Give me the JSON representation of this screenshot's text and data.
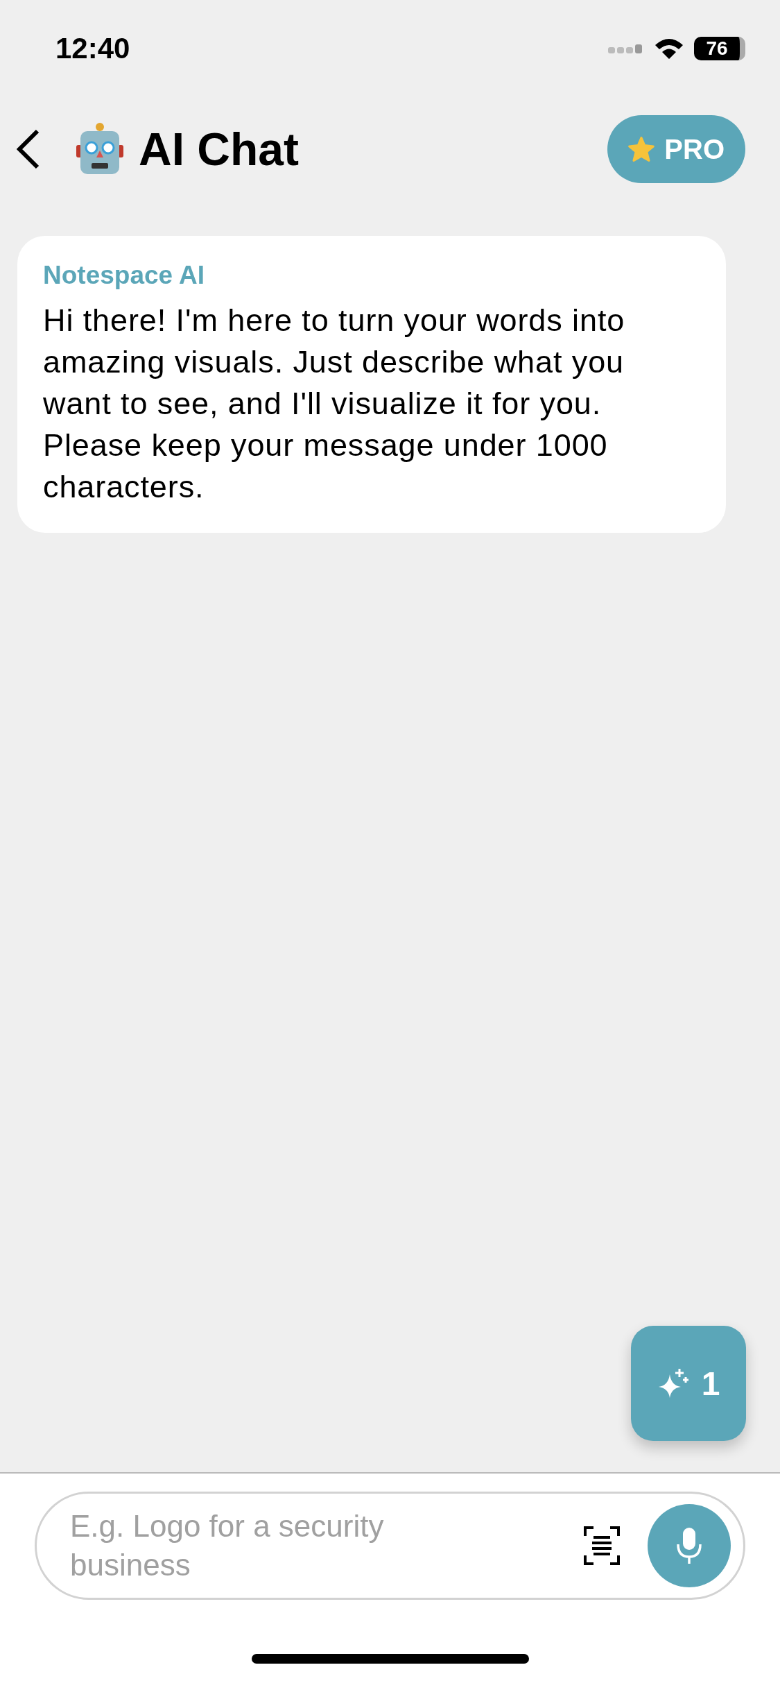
{
  "status_bar": {
    "time": "12:40",
    "battery": "76"
  },
  "header": {
    "title": "AI Chat",
    "pro_button": "PRO"
  },
  "messages": [
    {
      "sender": "Notespace AI",
      "text": "Hi there! I'm here to turn your words into amazing visuals. Just describe what you want to see, and I'll visualize it for you. Please keep your message under 1000 characters."
    }
  ],
  "credits_button": {
    "count": "1"
  },
  "composer": {
    "placeholder": "E.g. Logo for a security business"
  }
}
